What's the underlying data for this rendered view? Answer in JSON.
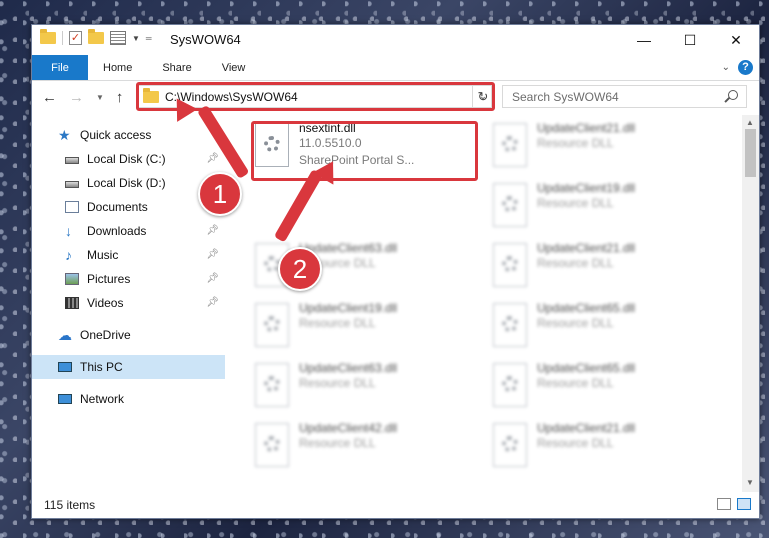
{
  "window": {
    "title": "SysWOW64"
  },
  "ribbon": {
    "tabs": [
      "File",
      "Home",
      "Share",
      "View"
    ],
    "help": "?"
  },
  "address": {
    "path": "C:\\Windows\\SysWOW64"
  },
  "search": {
    "placeholder": "Search SysWOW64"
  },
  "nav_pane": {
    "items": [
      {
        "label": "Quick access",
        "icon": "star-icon"
      },
      {
        "label": "Local Disk (C:)",
        "icon": "drive-icon",
        "pinned": true
      },
      {
        "label": "Local Disk (D:)",
        "icon": "drive-icon"
      },
      {
        "label": "Documents",
        "icon": "documents-icon"
      },
      {
        "label": "Downloads",
        "icon": "download-icon",
        "pinned": true
      },
      {
        "label": "Music",
        "icon": "music-icon",
        "pinned": true
      },
      {
        "label": "Pictures",
        "icon": "pictures-icon",
        "pinned": true
      },
      {
        "label": "Videos",
        "icon": "videos-icon",
        "pinned": true
      },
      {
        "label": "OneDrive",
        "icon": "cloud-icon"
      },
      {
        "label": "This PC",
        "icon": "computer-icon",
        "selected": true
      },
      {
        "label": "Network",
        "icon": "network-icon"
      }
    ]
  },
  "files": {
    "featured": {
      "name": "nsextint.dll",
      "version": "11.0.5510.0",
      "description": "SharePoint Portal S..."
    },
    "blurred": [
      {
        "name": "UpdateClient21.dll",
        "type": "Resource DLL"
      },
      {
        "name": "UpdateClient19.dll",
        "type": "Resource DLL"
      },
      {
        "name": "UpdateClient63.dll",
        "type": "Resource DLL"
      },
      {
        "name": "UpdateClient21.dll",
        "type": "Resource DLL"
      },
      {
        "name": "UpdateClient19.dll",
        "type": "Resource DLL"
      },
      {
        "name": "UpdateClient65.dll",
        "type": "Resource DLL"
      },
      {
        "name": "UpdateClient63.dll",
        "type": "Resource DLL"
      },
      {
        "name": "UpdateClient65.dll",
        "type": "Resource DLL"
      },
      {
        "name": "UpdateClient42.dll",
        "type": "Resource DLL"
      },
      {
        "name": "UpdateClient21.dll",
        "type": "Resource DLL"
      }
    ]
  },
  "status": {
    "item_count": "115 items"
  },
  "callouts": [
    "1",
    "2"
  ],
  "colors": {
    "accent": "#1979ca",
    "highlight": "#d9373d",
    "selected": "#cce4f7"
  }
}
